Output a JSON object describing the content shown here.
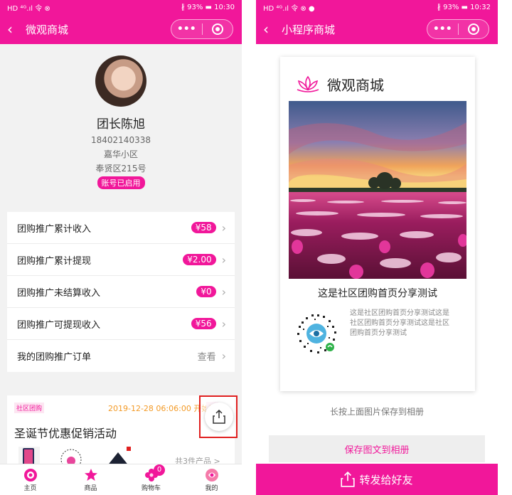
{
  "left": {
    "status": {
      "left_icons": "HD ⁴ᴳ.ıl 令 ⊗",
      "battery": "93%",
      "time": "10:30"
    },
    "nav": {
      "title": "微观商城",
      "capsule_more": "•••"
    },
    "profile": {
      "name": "团长陈旭",
      "phone": "18402140338",
      "community": "嘉华小区",
      "district": "奉贤区215号",
      "status_badge": "账号已启用"
    },
    "rows": [
      {
        "label": "团购推广累计收入",
        "value": "¥58"
      },
      {
        "label": "团购推广累计提现",
        "value": "¥2.00"
      },
      {
        "label": "团购推广未结算收入",
        "value": "¥0"
      },
      {
        "label": "团购推广可提现收入",
        "value": "¥56"
      },
      {
        "label": "我的团购推广订单",
        "value": "查看"
      }
    ],
    "activity": {
      "tag": "社区团购",
      "date": "2019-12-28 06:06:00 开始",
      "start_tag": "开",
      "title": "圣诞节优惠促销活动",
      "more": "共3件产品 >"
    },
    "tabs": [
      {
        "label": "主页"
      },
      {
        "label": "商品"
      },
      {
        "label": "购物车",
        "badge": "0"
      },
      {
        "label": "我的"
      }
    ]
  },
  "right": {
    "status": {
      "left_icons": "HD ⁴ᴳ.ıl 令 ⊗ ●",
      "battery": "93%",
      "time": "10:32"
    },
    "nav": {
      "title": "小程序商城",
      "capsule_more": "•••"
    },
    "poster": {
      "brand": "微观商城",
      "caption": "这是社区团购首页分享测试",
      "description": "这是社区团购首页分享测试这是社区团购首页分享测试这是社区团购首页分享测试"
    },
    "hint": "长按上面图片保存到相册",
    "save_button": "保存图文到相册",
    "forward_button": "转发给好友"
  },
  "colors": {
    "brand": "#f1179a",
    "highlight_border": "#e02020"
  }
}
